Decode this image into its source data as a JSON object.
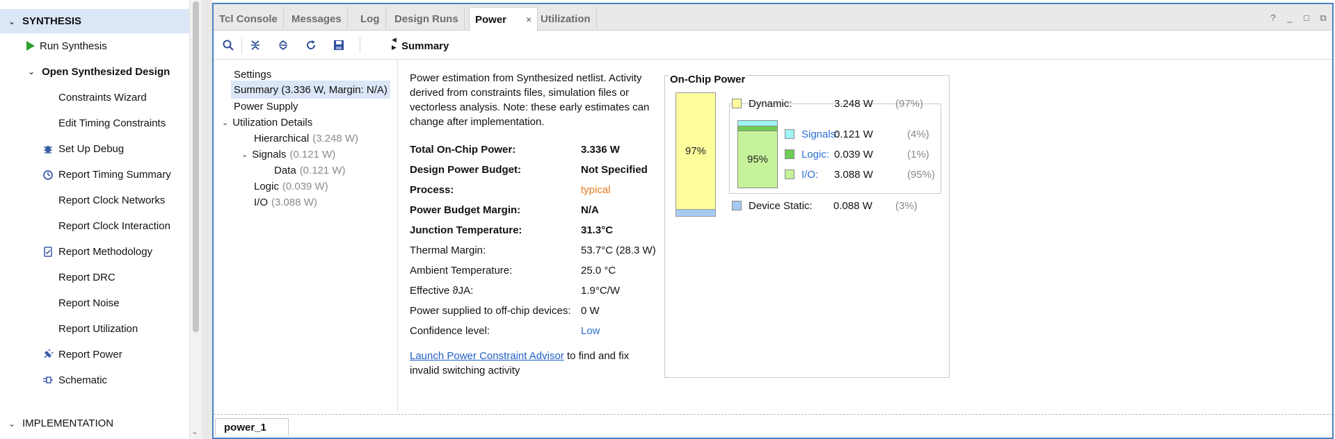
{
  "nav": {
    "synthesis": "SYNTHESIS",
    "run_synthesis": "Run Synthesis",
    "open_synth_design": "Open Synthesized Design",
    "items": [
      "Constraints Wizard",
      "Edit Timing Constraints",
      "Set Up Debug",
      "Report Timing Summary",
      "Report Clock Networks",
      "Report Clock Interaction",
      "Report Methodology",
      "Report DRC",
      "Report Noise",
      "Report Utilization",
      "Report Power",
      "Schematic"
    ],
    "implementation": "IMPLEMENTATION"
  },
  "tabs": [
    "Tcl Console",
    "Messages",
    "Log",
    "Design Runs",
    "Power",
    "Utilization"
  ],
  "tab_close": "×",
  "window_controls": [
    "?",
    "_",
    "□",
    "⧉"
  ],
  "toolbar": {
    "summary_title": "Summary"
  },
  "tree": {
    "settings": "Settings",
    "summary": "Summary (3.336 W, Margin: N/A)",
    "power_supply": "Power Supply",
    "util_details": "Utilization Details",
    "hierarchical": "Hierarchical",
    "hierarchical_val": "(3.248 W)",
    "signals": "Signals",
    "signals_val": "(0.121 W)",
    "data": "Data",
    "data_val": "(0.121 W)",
    "logic": "Logic",
    "logic_val": "(0.039 W)",
    "io": "I/O",
    "io_val": "(3.088 W)"
  },
  "summary": {
    "intro": "Power estimation from Synthesized netlist. Activity derived from constraints files, simulation files or vectorless analysis. Note: these early estimates can change after implementation.",
    "rows": [
      {
        "k": "Total On-Chip Power:",
        "v": "3.336 W"
      },
      {
        "k": "Design Power Budget:",
        "v": "Not Specified"
      },
      {
        "k": "Process:",
        "v": "typical"
      },
      {
        "k": "Power Budget Margin:",
        "v": "N/A"
      },
      {
        "k": "Junction Temperature:",
        "v": "31.3°C"
      },
      {
        "k": "Thermal Margin:",
        "v": "53.7°C (28.3 W)"
      },
      {
        "k": "Ambient Temperature:",
        "v": "25.0 °C"
      },
      {
        "k": "Effective ϑJA:",
        "v": "1.9°C/W"
      },
      {
        "k": "Power supplied to off-chip devices:",
        "v": "0 W"
      },
      {
        "k": "Confidence level:",
        "v": "Low"
      }
    ],
    "advisor_link": "Launch Power Constraint Advisor",
    "advisor_text": " to find and fix invalid switching activity"
  },
  "on_chip": {
    "title": "On-Chip Power",
    "dynamic_bar_label": "97%",
    "io_bar_label": "95%",
    "dynamic": {
      "label": "Dynamic:",
      "watts": "3.248 W",
      "pct": "(97%)"
    },
    "signals": {
      "label": "Signals:",
      "watts": "0.121 W",
      "pct": "(4%)"
    },
    "logic": {
      "label": "Logic:",
      "watts": "0.039 W",
      "pct": "(1%)"
    },
    "io": {
      "label": "I/O:",
      "watts": "3.088 W",
      "pct": "(95%)"
    },
    "device_static": {
      "label": "Device Static:",
      "watts": "0.088 W",
      "pct": "(3%)"
    }
  },
  "bottom_tab": "power_1",
  "colors": {
    "dynamic": "#fdfd9c",
    "signals": "#9ef3f6",
    "logic": "#6fcc55",
    "io": "#c5f29b",
    "static": "#a7c9f4",
    "accent": "#4a7fc4"
  }
}
